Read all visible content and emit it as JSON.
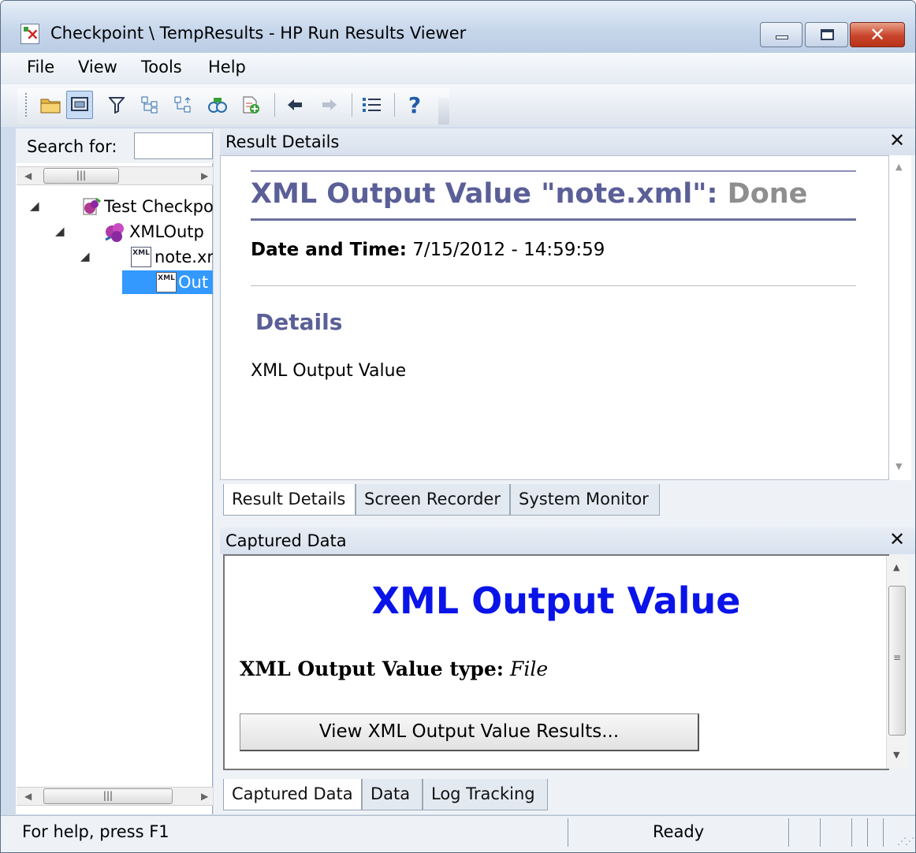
{
  "window": {
    "title": "Checkpoint \\ TempResults - HP Run Results Viewer",
    "app_icon": "results-viewer-icon",
    "controls": [
      "minimize",
      "maximize",
      "close"
    ]
  },
  "menu": [
    "File",
    "View",
    "Tools",
    "Help"
  ],
  "toolbar": {
    "icons": [
      "open-folder-icon",
      "print-icon",
      "filter-icon",
      "expand-all-icon",
      "collapse-all-icon",
      "find-icon",
      "add-document-icon",
      "back-arrow-icon",
      "forward-arrow-icon",
      "list-icon",
      "help-icon"
    ]
  },
  "left_pane": {
    "search_label": "Search for:",
    "search_value": "",
    "tree": [
      {
        "label": "Test Checkpo",
        "icon": "test-icon",
        "expanded": true
      },
      {
        "label": "XMLOutp",
        "icon": "action-icon",
        "expanded": true
      },
      {
        "label": "note.xr",
        "icon": "xml-file-icon",
        "expanded": true
      },
      {
        "label": "Out",
        "icon": "xml-file-icon",
        "selected": true
      }
    ]
  },
  "result_details": {
    "panel_title": "Result Details",
    "heading_main": "XML Output Value \"note.xml\":",
    "heading_status": "Done",
    "date_label": "Date and Time:",
    "date_value": "7/15/2012 - 14:59:59",
    "details_heading": "Details",
    "details_text": "XML Output Value"
  },
  "top_tabs": [
    "Result Details",
    "Screen Recorder",
    "System Monitor"
  ],
  "captured_data": {
    "panel_title": "Captured Data",
    "heading": "XML Output Value",
    "type_label": "XML Output Value type:",
    "type_value": "File",
    "button_label": "View XML Output Value Results..."
  },
  "bottom_tabs": [
    "Captured Data",
    "Data",
    "Log Tracking"
  ],
  "status": {
    "help_text": "For help, press F1",
    "state": "Ready"
  },
  "colors": {
    "heading_purple": "#5b5f97",
    "status_gray": "#8e8e8e",
    "captured_heading_blue": "#0a14e8",
    "selection_blue": "#3399ff"
  }
}
